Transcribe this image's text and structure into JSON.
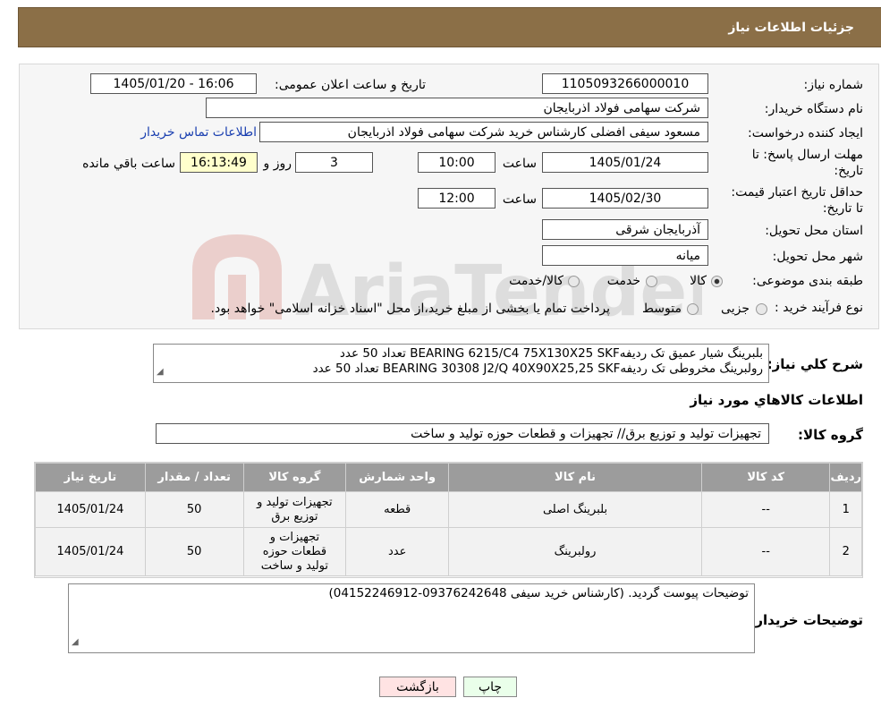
{
  "header": {
    "title": "جزئیات اطلاعات نیاز"
  },
  "form": {
    "need_number_label": "شماره نیاز:",
    "need_number": "1105093266000010",
    "announce_label": "تاریخ و ساعت اعلان عمومی:",
    "announce_value": "1405/01/20 - 16:06",
    "buyer_org_label": "نام دستگاه خریدار:",
    "buyer_org": "شرکت سهامی فولاد اذربایجان",
    "creator_label": "ایجاد کننده درخواست:",
    "creator": "مسعود سیفی افضلی کارشناس خرید شرکت سهامی فولاد اذربایجان",
    "contact_link": "اطلاعات تماس خریدار",
    "deadline_label": "مهلت ارسال پاسخ: تا تاریخ:",
    "deadline_date": "1405/01/24",
    "time_label": "ساعت",
    "deadline_time": "10:00",
    "days_value": "3",
    "days_label": "روز و",
    "remaining_time": "16:13:49",
    "remaining_label": "ساعت باقي مانده",
    "validity_label": "حداقل تاریخ اعتبار قیمت: تا تاریخ:",
    "validity_date": "1405/02/30",
    "validity_time": "12:00",
    "province_label": "استان محل تحویل:",
    "province": "آذربایجان شرقی",
    "city_label": "شهر محل تحویل:",
    "city": "میانه",
    "category_label": "طبقه بندی موضوعی:",
    "category_options": [
      "کالا",
      "خدمت",
      "کالا/خدمت"
    ],
    "process_label": "نوع فرآیند خرید :",
    "process_options": [
      "جزیی",
      "متوسط"
    ],
    "process_note": "پرداخت تمام یا بخشی از مبلغ خرید،از محل \"اسناد خزانه اسلامی\" خواهد بود."
  },
  "summary": {
    "label": "شرح کلي نیاز:",
    "line1": "بلبرینگ شیار عمیق تک ردیفهBEARING 6215/C4 75X130X25 SKF تعداد 50 عدد",
    "line2": "رولبرینگ مخروطی تک ردیفهBEARING 30308 J2/Q 40X90X25,25 SKF تعداد 50 عدد"
  },
  "goods_info_title": "اطلاعات کالاهاي مورد نیاز",
  "goods_group": {
    "label": "گروه کالا:",
    "value": "تجهیزات تولید و توزیع برق// تجهیزات و قطعات حوزه تولید و ساخت"
  },
  "table": {
    "headers": [
      "ردیف",
      "کد کالا",
      "نام کالا",
      "واحد شمارش",
      "گروه کالا",
      "تعداد / مقدار",
      "تاریخ نیاز"
    ],
    "rows": [
      {
        "idx": "1",
        "code": "--",
        "name": "بلبرینگ اصلی",
        "unit": "قطعه",
        "group": "تجهیزات تولید و توزیع برق",
        "qty": "50",
        "date": "1405/01/24"
      },
      {
        "idx": "2",
        "code": "--",
        "name": "رولبرینگ",
        "unit": "عدد",
        "group": "تجهیزات و قطعات حوزه تولید و ساخت",
        "qty": "50",
        "date": "1405/01/24"
      }
    ]
  },
  "buyer_notes": {
    "label": "توضیحات خریدار:",
    "text": "توضیحات پیوست گردید. (کارشناس خرید سیفی 09376242648-04152246912)"
  },
  "buttons": {
    "print": "چاپ",
    "back": "بازگشت"
  },
  "watermark": {
    "text": "AriaTender.neT"
  },
  "colors": {
    "header_bg": "#8b6f47",
    "table_header_bg": "#9c9c9c",
    "link": "#1a3fb0",
    "remaining_bg": "#ffffcc"
  }
}
